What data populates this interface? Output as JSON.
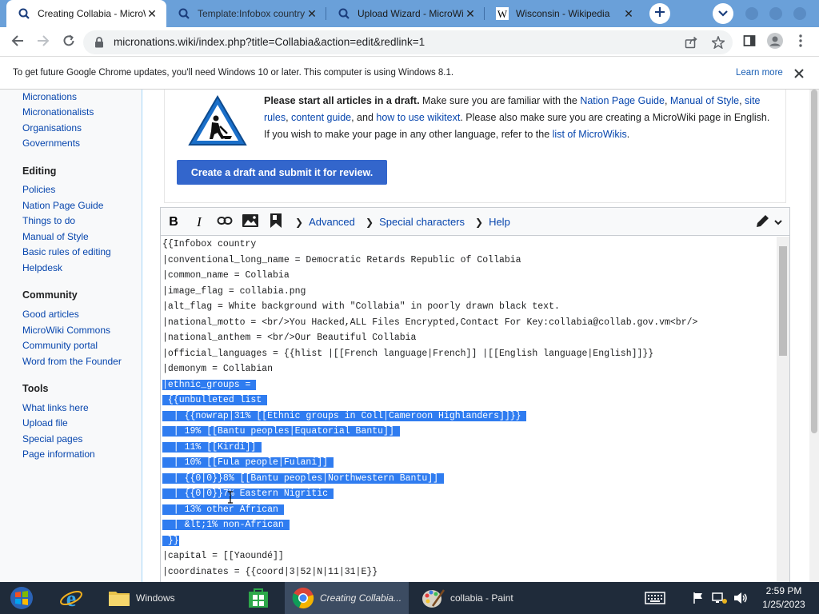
{
  "browser": {
    "tabs": [
      {
        "title": "Creating Collabia - MicroWiki",
        "favicon": "micronations-icon",
        "active": true
      },
      {
        "title": "Template:Infobox country - M",
        "favicon": "micronations-icon",
        "active": false
      },
      {
        "title": "Upload Wizard - MicroWiki",
        "favicon": "micronations-icon",
        "active": false
      },
      {
        "title": "Wisconsin - Wikipedia",
        "favicon": "wikipedia-icon",
        "active": false
      }
    ],
    "url": "micronations.wiki/index.php?title=Collabia&action=edit&redlink=1",
    "accent": "#6aa0d9"
  },
  "infobar": {
    "message": "To get future Google Chrome updates, you'll need Windows 10 or later. This computer is using Windows 8.1.",
    "learn_more": "Learn more"
  },
  "sidebar": {
    "top_links": [
      "Micronations",
      "Micronationalists",
      "Organisations",
      "Governments"
    ],
    "sections": [
      {
        "heading": "Editing",
        "links": [
          "Policies",
          "Nation Page Guide",
          "Things to do",
          "Manual of Style",
          "Basic rules of editing",
          "Helpdesk"
        ]
      },
      {
        "heading": "Community",
        "links": [
          "Good articles",
          "MicroWiki Commons",
          "Community portal",
          "Word from the Founder"
        ]
      },
      {
        "heading": "Tools",
        "links": [
          "What links here",
          "Upload file",
          "Special pages",
          "Page information"
        ]
      }
    ]
  },
  "notice": {
    "bold_lead": "Please start all articles in a draft.",
    "t1": " Make sure you are familiar with the ",
    "l1": "Nation Page Guide",
    "t2": ", ",
    "l2": "Manual of Style",
    "t3": ", ",
    "l3": "site rules",
    "t4": ", ",
    "l4": "content guide",
    "t5": ", and ",
    "l5": "how to use wikitext",
    "t6": ". Please also make sure you are creating a MicroWiki page in English. If you wish to make your page in any other language, refer to the ",
    "l6": "list of MicroWikis",
    "t7": ".",
    "button": "Create a draft and submit it for review."
  },
  "editor": {
    "toolbar": {
      "bold": "B",
      "italic": "I",
      "advanced": "Advanced",
      "special_characters": "Special characters",
      "help": "Help"
    },
    "lines": [
      {
        "text": "{{Infobox country",
        "selected": false
      },
      {
        "text": "|conventional_long_name = Democratic Retards Republic of Collabia",
        "selected": false
      },
      {
        "text": "|common_name = Collabia",
        "selected": false
      },
      {
        "text": "|image_flag = collabia.png",
        "selected": false
      },
      {
        "text": "|alt_flag = White background with \"Collabia\" in poorly drawn black text.",
        "selected": false
      },
      {
        "text": "|national_motto = <br/>You Hacked,ALL Files Encrypted,Contact For Key:collabia@collab.gov.vm<br/>",
        "selected": false
      },
      {
        "text": "|national_anthem = <br/>Our Beautiful Collabia",
        "selected": false
      },
      {
        "text": "|official_languages = {{hlist |[[French language|French]] |[[English language|English]]}}",
        "selected": false
      },
      {
        "text": "|demonym = Collabian",
        "selected": false
      },
      {
        "text": "|ethnic_groups = ",
        "selected": true
      },
      {
        "text": " {{unbulleted list ",
        "selected": true
      },
      {
        "text": "  | {{nowrap|31% [[Ethnic groups in Coll|Cameroon Highlanders]]}} ",
        "selected": true
      },
      {
        "text": "  | 19% [[Bantu peoples|Equatorial Bantu]] ",
        "selected": true
      },
      {
        "text": "  | 11% [[Kirdi]] ",
        "selected": true
      },
      {
        "text": "  | 10% [[Fula people|Fulani]] ",
        "selected": true
      },
      {
        "text": "  | {{0|0}}8% [[Bantu peoples|Northwestern Bantu]] ",
        "selected": true
      },
      {
        "text": "  | {{0|0}}7% Eastern Nigritic ",
        "selected": true
      },
      {
        "text": "  | 13% other African ",
        "selected": true
      },
      {
        "text": "  | &lt;1% non-African ",
        "selected": true
      },
      {
        "text": " }}",
        "selected": true
      },
      {
        "text": "|capital = [[Yaoundé]]",
        "selected": false
      },
      {
        "text": "|coordinates = {{coord|3|52|N|11|31|E}}",
        "selected": false
      }
    ]
  },
  "taskbar": {
    "items": [
      {
        "label": "",
        "icon": "start-icon"
      },
      {
        "label": "",
        "icon": "internet-explorer-icon"
      },
      {
        "label": "Windows",
        "icon": "folder-icon"
      },
      {
        "label": "",
        "icon": "store-icon"
      },
      {
        "label": "Creating Collabia...",
        "icon": "chrome-icon"
      },
      {
        "label": "collabia - Paint",
        "icon": "paint-icon"
      }
    ],
    "clock": {
      "time": "2:59 PM",
      "date": "1/25/2023"
    }
  }
}
